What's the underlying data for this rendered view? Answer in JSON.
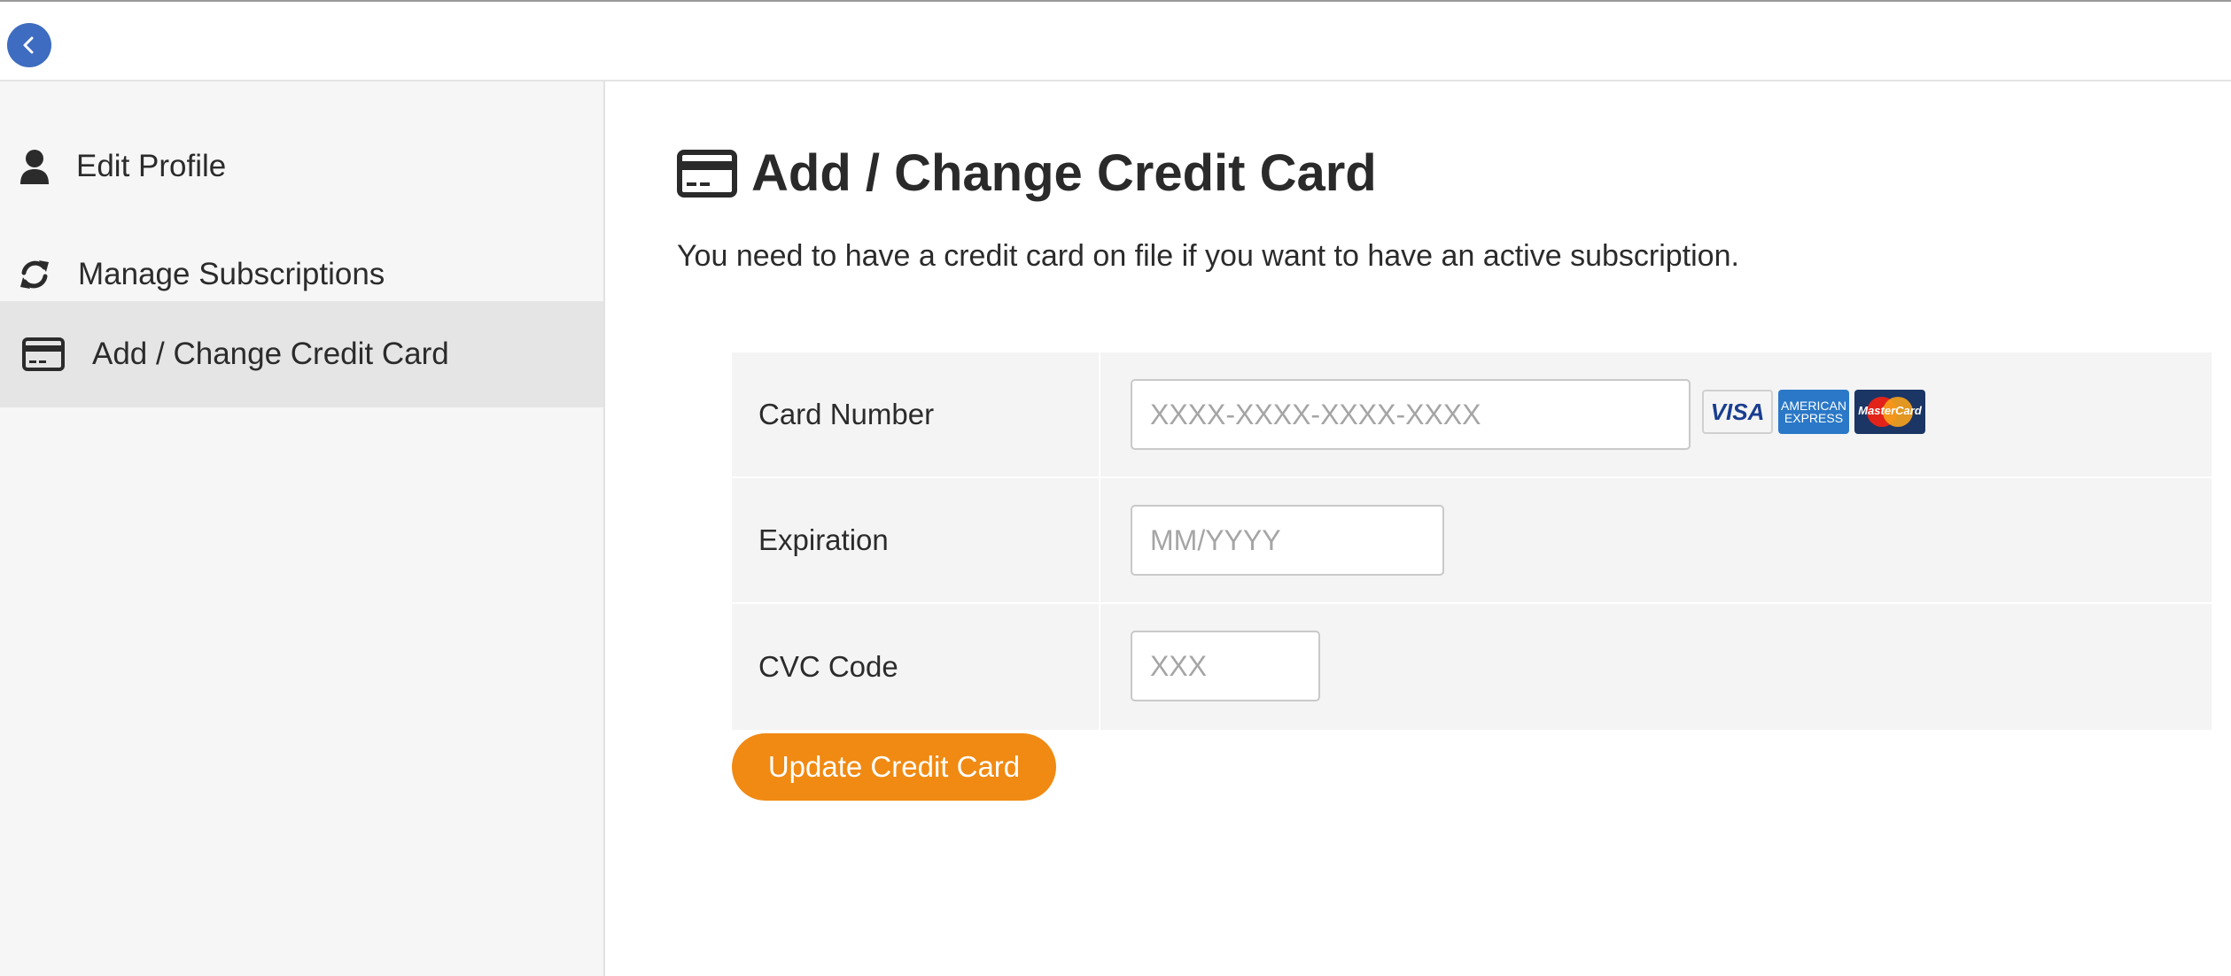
{
  "topbar": {
    "back_icon": "chevron-left-icon"
  },
  "sidebar": {
    "items": [
      {
        "label": "Edit Profile",
        "icon": "user-icon",
        "active": false
      },
      {
        "label": "Manage Subscriptions",
        "icon": "refresh-icon",
        "active": false
      },
      {
        "label": "Add / Change Credit Card",
        "icon": "credit-card-icon",
        "active": true
      }
    ]
  },
  "main": {
    "title": "Add / Change Credit Card",
    "title_icon": "credit-card-icon",
    "description": "You need to have a credit card on file if you want to have an active subscription."
  },
  "form": {
    "card_number": {
      "label": "Card Number",
      "placeholder": "XXXX-XXXX-XXXX-XXXX",
      "value": ""
    },
    "expiration": {
      "label": "Expiration",
      "placeholder": "MM/YYYY",
      "value": ""
    },
    "cvc": {
      "label": "CVC Code",
      "placeholder": "XXX",
      "value": ""
    },
    "card_logos": {
      "visa": "VISA",
      "amex_line1": "AMERICAN",
      "amex_line2": "EXPRESS",
      "mastercard": "MasterCard"
    },
    "submit_label": "Update Credit Card"
  },
  "colors": {
    "accent": "#f08a13",
    "back_button": "#3d6cc0",
    "sidebar_bg": "#f6f6f6",
    "sidebar_active_bg": "#e5e5e5"
  }
}
